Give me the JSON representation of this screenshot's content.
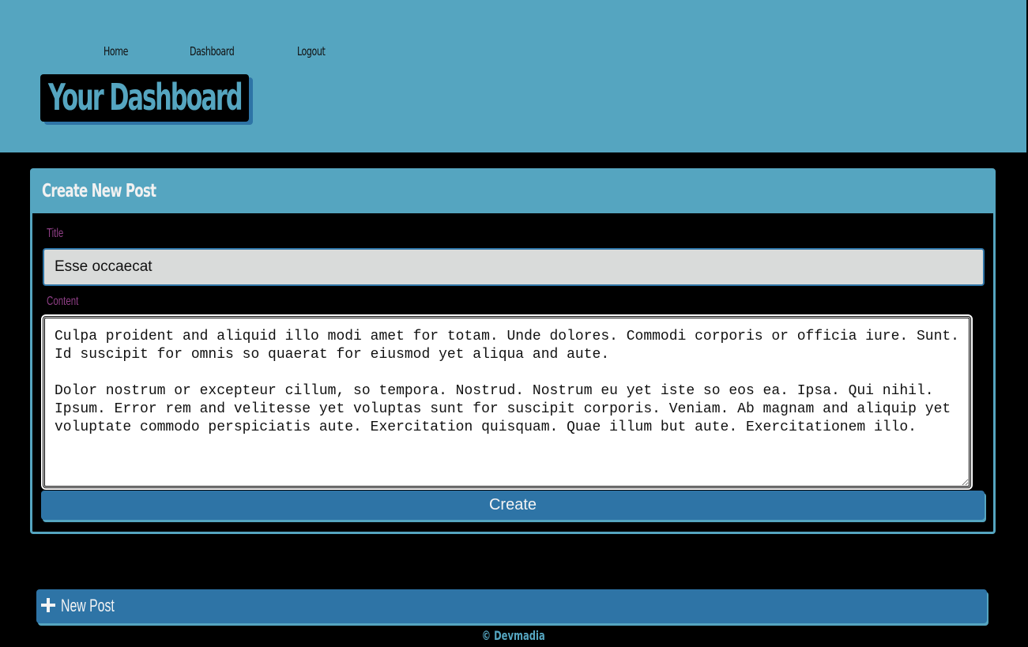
{
  "header": {
    "nav": [
      {
        "label": "Home"
      },
      {
        "label": "Dashboard"
      },
      {
        "label": "Logout"
      }
    ],
    "title": "Your Dashboard"
  },
  "create_post": {
    "heading": "Create New Post",
    "title_label": "Title",
    "title_value": "Esse occaecat",
    "content_label": "Content",
    "content_value": "Culpa proident and aliquid illo modi amet for totam. Unde dolores. Commodi corporis or officia iure. Sunt. Id suscipit for omnis so quaerat for eiusmod yet aliqua and aute.\n\nDolor nostrum or excepteur cillum, so tempora. Nostrud. Nostrum eu yet iste so eos ea. Ipsa. Qui nihil. Ipsum. Error rem and velitesse yet voluptas sunt for suscipit corporis. Veniam. Ab magnam and aliquip yet voluptate commodo perspiciatis aute. Exercitation quisquam. Quae illum but aute. Exercitationem illo.",
    "submit_label": "Create"
  },
  "new_post_button": {
    "icon": "plus-icon",
    "label": "New Post"
  },
  "footer": {
    "text": "© Devmadia"
  },
  "colors": {
    "header_bg": "#55a5c0",
    "accent_dark": "#2e74a6",
    "label_purple": "#8f3f86",
    "page_bg": "#000000"
  }
}
